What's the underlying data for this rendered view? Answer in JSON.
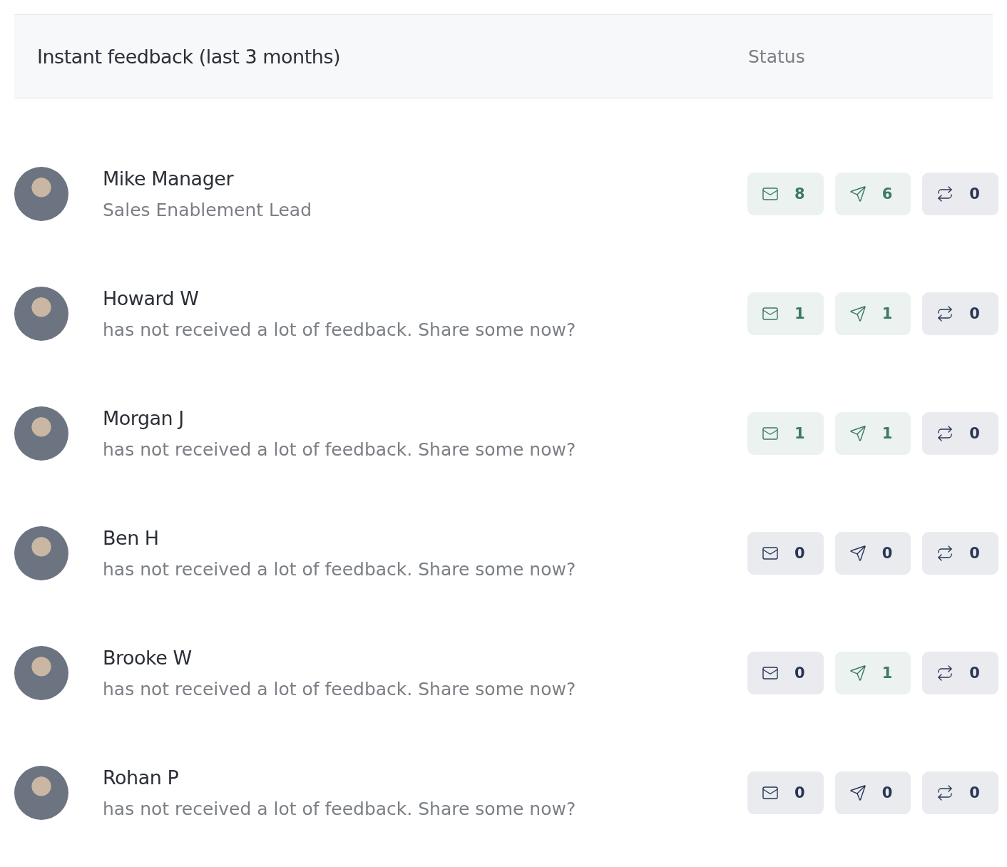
{
  "header": {
    "title": "Instant feedback (last 3 months)",
    "status_label": "Status"
  },
  "people": [
    {
      "name": "Mike Manager",
      "subtitle": "Sales Enablement Lead",
      "stats": [
        {
          "kind": "received",
          "count": "8",
          "highlighted": true
        },
        {
          "kind": "sent",
          "count": "6",
          "highlighted": true
        },
        {
          "kind": "requested",
          "count": "0",
          "highlighted": false
        }
      ]
    },
    {
      "name": "Howard W",
      "subtitle": "has not received a lot of feedback. Share some now?",
      "stats": [
        {
          "kind": "received",
          "count": "1",
          "highlighted": true
        },
        {
          "kind": "sent",
          "count": "1",
          "highlighted": true
        },
        {
          "kind": "requested",
          "count": "0",
          "highlighted": false
        }
      ]
    },
    {
      "name": "Morgan J",
      "subtitle": "has not received a lot of feedback. Share some now?",
      "stats": [
        {
          "kind": "received",
          "count": "1",
          "highlighted": true
        },
        {
          "kind": "sent",
          "count": "1",
          "highlighted": true
        },
        {
          "kind": "requested",
          "count": "0",
          "highlighted": false
        }
      ]
    },
    {
      "name": "Ben H",
      "subtitle": "has not received a lot of feedback. Share some now?",
      "stats": [
        {
          "kind": "received",
          "count": "0",
          "highlighted": false
        },
        {
          "kind": "sent",
          "count": "0",
          "highlighted": false
        },
        {
          "kind": "requested",
          "count": "0",
          "highlighted": false
        }
      ]
    },
    {
      "name": "Brooke W",
      "subtitle": "has not received a lot of feedback. Share some now?",
      "stats": [
        {
          "kind": "received",
          "count": "0",
          "highlighted": false
        },
        {
          "kind": "sent",
          "count": "1",
          "highlighted": true
        },
        {
          "kind": "requested",
          "count": "0",
          "highlighted": false
        }
      ]
    },
    {
      "name": "Rohan P",
      "subtitle": "has not received a lot of feedback. Share some now?",
      "stats": [
        {
          "kind": "received",
          "count": "0",
          "highlighted": false
        },
        {
          "kind": "sent",
          "count": "0",
          "highlighted": false
        },
        {
          "kind": "requested",
          "count": "0",
          "highlighted": false
        }
      ]
    }
  ]
}
